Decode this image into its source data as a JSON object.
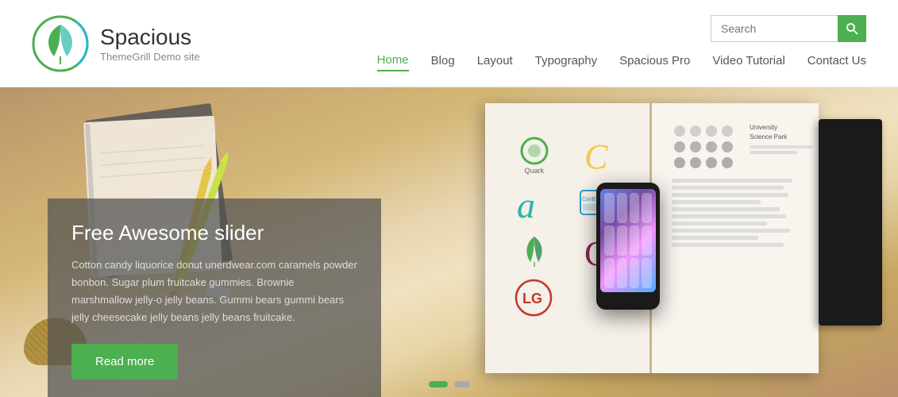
{
  "site": {
    "title": "Spacious",
    "tagline": "ThemeGrill Demo site",
    "logo_alt": "Spacious logo"
  },
  "search": {
    "placeholder": "Search",
    "button_label": "🔍"
  },
  "nav": {
    "items": [
      {
        "label": "Home",
        "active": true
      },
      {
        "label": "Blog",
        "active": false
      },
      {
        "label": "Layout",
        "active": false
      },
      {
        "label": "Typography",
        "active": false
      },
      {
        "label": "Spacious Pro",
        "active": false
      },
      {
        "label": "Video Tutorial",
        "active": false
      },
      {
        "label": "Contact Us",
        "active": false
      }
    ]
  },
  "slider": {
    "title": "Free Awesome slider",
    "text": "Cotton candy liquorice donut unerdwear.com caramels powder bonbon. Sugar plum fruitcake gummies. Brownie marshmallow jelly-o jelly beans. Gummi bears gummi bears jelly cheesecake jelly beans jelly beans fruitcake.",
    "read_more": "Read more",
    "dots": [
      {
        "active": true
      },
      {
        "active": false
      }
    ]
  }
}
